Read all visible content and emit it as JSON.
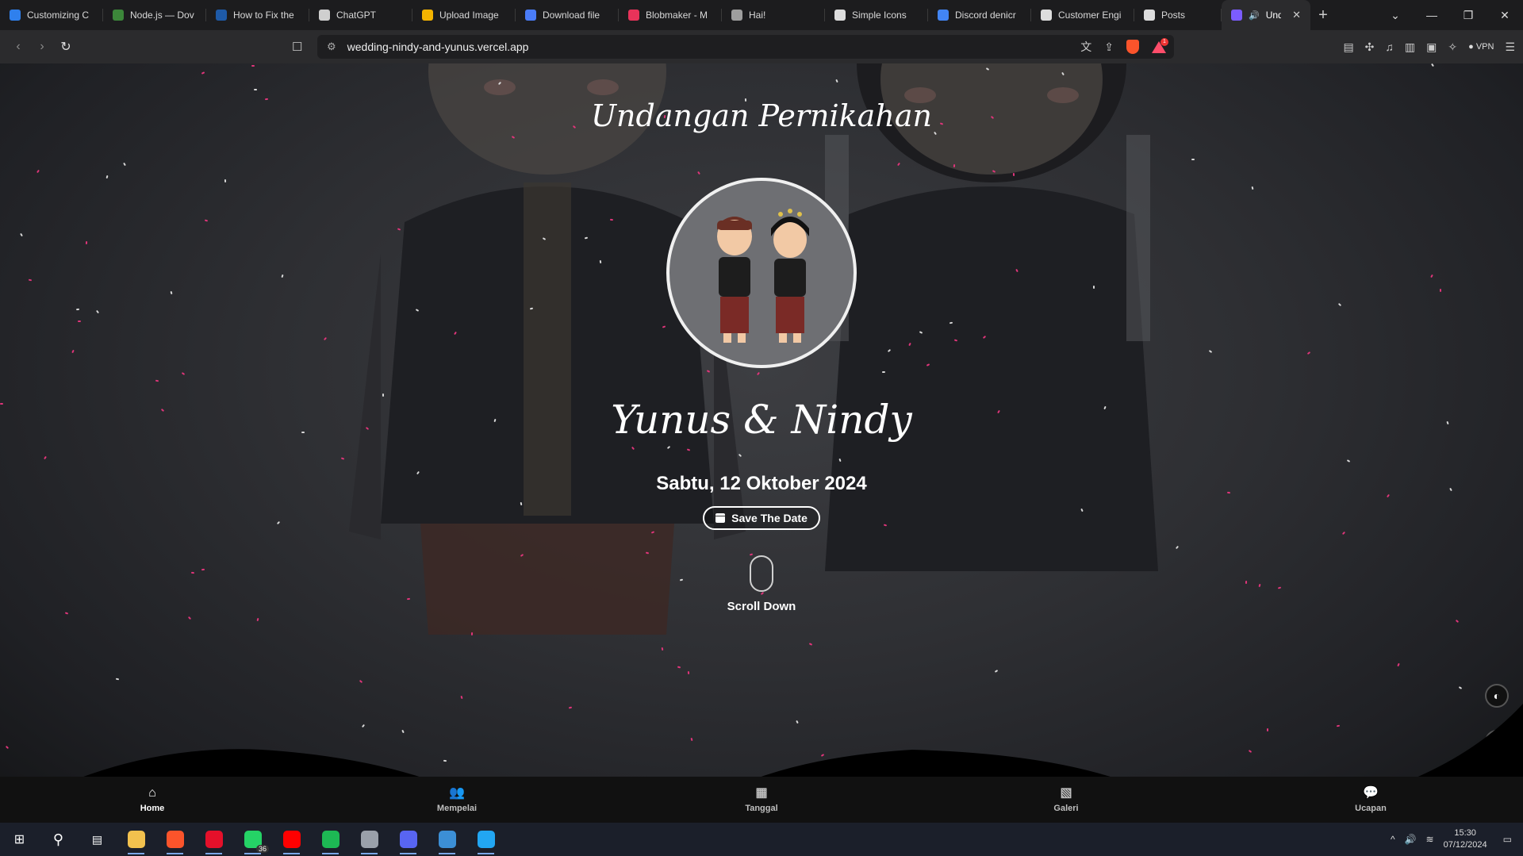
{
  "browser": {
    "tabs": [
      {
        "title": "Customizing C",
        "color": "#2f80ed"
      },
      {
        "title": "Node.js — Dov",
        "color": "#3c873a"
      },
      {
        "title": "How to Fix the",
        "color": "#1e5aa8"
      },
      {
        "title": "ChatGPT",
        "color": "#cfcfcf"
      },
      {
        "title": "Upload Image",
        "color": "#f4b400"
      },
      {
        "title": "Download file",
        "color": "#4a7cf7"
      },
      {
        "title": "Blobmaker - M",
        "color": "#e8335a"
      },
      {
        "title": "Hai!",
        "color": "#9e9e9e"
      },
      {
        "title": "Simple Icons",
        "color": "#dddddd"
      },
      {
        "title": "Discord denicr",
        "color": "#4285f4"
      },
      {
        "title": "Customer Engi",
        "color": "#dddddd"
      },
      {
        "title": "Posts",
        "color": "#dddddd"
      }
    ],
    "active_tab": {
      "title": "Undang",
      "color": "#7b5cff"
    },
    "url": "wedding-nindy-and-yunus.vercel.app",
    "bat_badge": "1",
    "vpn_label": "VPN"
  },
  "page": {
    "title": "Undangan Pernikahan",
    "couple": "Yunus & Nindy",
    "date": "Sabtu, 12 Oktober 2024",
    "save_button": "Save The Date",
    "scroll_hint": "Scroll Down"
  },
  "bottom_nav": [
    {
      "label": "Home",
      "icon": "home-icon",
      "active": true
    },
    {
      "label": "Mempelai",
      "icon": "people-icon",
      "active": false
    },
    {
      "label": "Tanggal",
      "icon": "calendar-icon",
      "active": false
    },
    {
      "label": "Galeri",
      "icon": "gallery-icon",
      "active": false
    },
    {
      "label": "Ucapan",
      "icon": "chat-icon",
      "active": false
    }
  ],
  "floating": {
    "theme_toggle": "contrast-icon",
    "music_toggle": "music-icon"
  },
  "taskbar": {
    "apps": [
      {
        "name": "file-explorer",
        "color": "#f2c14e"
      },
      {
        "name": "brave-browser",
        "color": "#fb542b"
      },
      {
        "name": "opera",
        "color": "#e5102a"
      },
      {
        "name": "whatsapp",
        "color": "#25d366",
        "badge": "36"
      },
      {
        "name": "youtube",
        "color": "#ff0000"
      },
      {
        "name": "spotify",
        "color": "#1db954"
      },
      {
        "name": "app-brush",
        "color": "#9aa0aa"
      },
      {
        "name": "discord",
        "color": "#5865f2"
      },
      {
        "name": "app-window",
        "color": "#3c8fd6"
      },
      {
        "name": "vscode",
        "color": "#22a6f2"
      }
    ],
    "time": "15:30",
    "date": "07/12/2024"
  }
}
